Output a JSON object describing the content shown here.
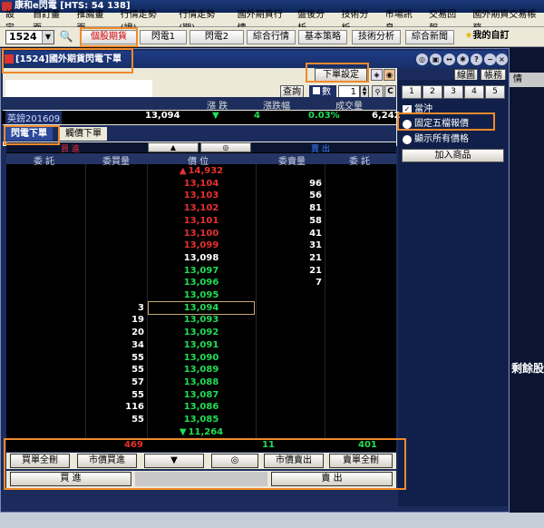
{
  "app": {
    "title": "康和e閃電 [HTS: 54 138]"
  },
  "menu": [
    "設定",
    "自訂畫面",
    "推薦畫面",
    "行情走勢(證)",
    "行情走勢(期)",
    "國外期貨行情",
    "盤後分析",
    "技術分析",
    "市場訊息",
    "交易回報",
    "國外期貨交易帳務"
  ],
  "toolbar": {
    "code": "1524",
    "buttons": [
      "個股期貨",
      "閃電1",
      "閃電2",
      "綜合行情",
      "基本策略",
      "技術分析",
      "綜合新聞"
    ],
    "my_custom": "我的自訂"
  },
  "window": {
    "title": "[1524]國外期貨閃電下單",
    "order_settings": "下單設定",
    "query_label": "查詢",
    "qty_label": "數",
    "qty_value": "1",
    "c_btn": "C",
    "chart_btn": "線圖",
    "account_btn": "帳務",
    "number_tabs": [
      "1",
      "2",
      "3",
      "4",
      "5"
    ]
  },
  "quote": {
    "headers": [
      "漲 跌",
      "漲跌幅",
      "成交量"
    ],
    "symbol": "英鎊201609",
    "last": "13,094",
    "change": "4",
    "change_pct": "0.03%",
    "volume": "6,242"
  },
  "tabs": [
    "閃電下單",
    "觸價下單"
  ],
  "options": {
    "hedge": "當沖",
    "fixed_five": "固定五檔報價",
    "show_all": "顯示所有價格",
    "add_item": "加入商品"
  },
  "ladder": {
    "buy_side": "買 進",
    "sell_side": "賣 出",
    "scroll_up": "▲",
    "scroll_mid": "◎",
    "columns": [
      "委 託",
      "委買量",
      "價 位",
      "委賣量",
      "委 託"
    ],
    "rows": [
      {
        "buy": "",
        "price": "14,932",
        "sell": "",
        "color": "#e83030",
        "arrow": "▲"
      },
      {
        "buy": "",
        "price": "13,104",
        "sell": "96",
        "color": "#e83030"
      },
      {
        "buy": "",
        "price": "13,103",
        "sell": "56",
        "color": "#e83030"
      },
      {
        "buy": "",
        "price": "13,102",
        "sell": "81",
        "color": "#e83030"
      },
      {
        "buy": "",
        "price": "13,101",
        "sell": "58",
        "color": "#e83030"
      },
      {
        "buy": "",
        "price": "13,100",
        "sell": "41",
        "color": "#e83030"
      },
      {
        "buy": "",
        "price": "13,099",
        "sell": "31",
        "color": "#e83030"
      },
      {
        "buy": "",
        "price": "13,098",
        "sell": "21",
        "color": "#ffffff"
      },
      {
        "buy": "",
        "price": "13,097",
        "sell": "21",
        "color": "#22dd55"
      },
      {
        "buy": "",
        "price": "13,096",
        "sell": "7",
        "color": "#22dd55"
      },
      {
        "buy": "",
        "price": "13,095",
        "sell": "",
        "color": "#22dd55"
      },
      {
        "buy": "3",
        "price": "13,094",
        "sell": "",
        "color": "#22dd55"
      },
      {
        "buy": "19",
        "price": "13,093",
        "sell": "",
        "color": "#22dd55"
      },
      {
        "buy": "20",
        "price": "13,092",
        "sell": "",
        "color": "#22dd55"
      },
      {
        "buy": "34",
        "price": "13,091",
        "sell": "",
        "color": "#22dd55"
      },
      {
        "buy": "55",
        "price": "13,090",
        "sell": "",
        "color": "#22dd55"
      },
      {
        "buy": "55",
        "price": "13,089",
        "sell": "",
        "color": "#22dd55"
      },
      {
        "buy": "57",
        "price": "13,088",
        "sell": "",
        "color": "#22dd55"
      },
      {
        "buy": "55",
        "price": "13,087",
        "sell": "",
        "color": "#22dd55"
      },
      {
        "buy": "116",
        "price": "13,086",
        "sell": "",
        "color": "#22dd55"
      },
      {
        "buy": "55",
        "price": "13,085",
        "sell": "",
        "color": "#22dd55"
      },
      {
        "buy": "",
        "price": "11,264",
        "sell": "",
        "color": "#22dd55",
        "arrow": "▼"
      }
    ],
    "sum_buy": "469",
    "sum_mid": "11",
    "sum_sell": "401"
  },
  "actions": {
    "cancel_all_buy": "買單全刪",
    "market_buy": "市價買進",
    "down": "▼",
    "center": "◎",
    "market_sell": "市價賣出",
    "cancel_all_sell": "賣單全刪",
    "buy": "買 進",
    "sell": "賣 出"
  },
  "background": {
    "right_tab": "情",
    "right_text": "剩餘股"
  },
  "colors": {
    "up": "#e83030",
    "down": "#22dd55",
    "highlight": "#f08a2a"
  }
}
